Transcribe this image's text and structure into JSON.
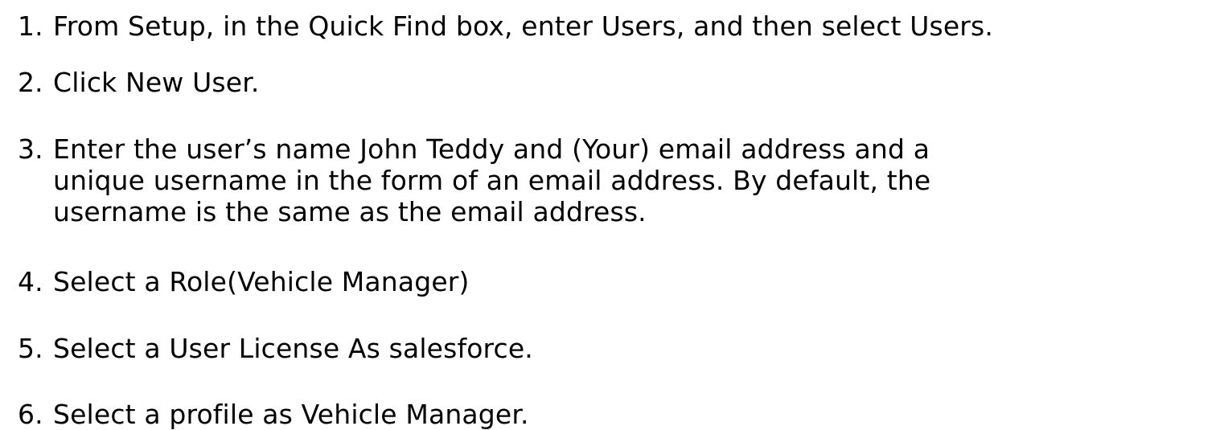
{
  "steps": [
    {
      "number": "1.",
      "lines": [
        "From Setup, in the Quick Find box, enter Users, and then select Users."
      ]
    },
    {
      "number": "2.",
      "lines": [
        "Click New User."
      ]
    },
    {
      "number": "3.",
      "lines": [
        "Enter the user’s name John Teddy and (Your) email address and a",
        "unique username in the form of an email address. By default, the",
        "username is the same as the email address."
      ]
    },
    {
      "number": "4.",
      "lines": [
        "Select a Role(Vehicle Manager)"
      ]
    },
    {
      "number": "5.",
      "lines": [
        "Select a User License As salesforce."
      ]
    },
    {
      "number": "6.",
      "lines": [
        "Select a profile as Vehicle Manager."
      ]
    }
  ]
}
